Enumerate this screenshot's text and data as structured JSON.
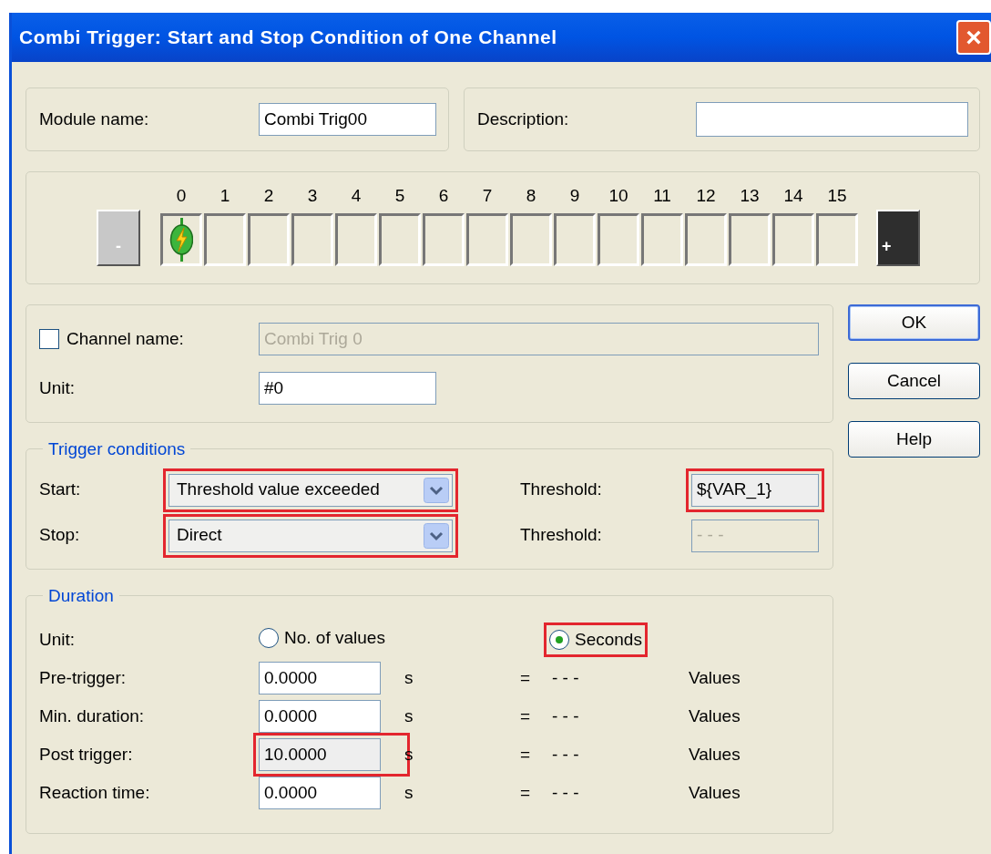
{
  "window": {
    "title": "Combi Trigger: Start and Stop Condition of One Channel",
    "close": "×"
  },
  "module": {
    "name_label": "Module name:",
    "name_value": "Combi Trig00",
    "description_label": "Description:"
  },
  "strip": {
    "prev": {
      "symbol": "-",
      "disabled": true
    },
    "next": {
      "symbol": "+",
      "disabled": false
    },
    "channels": [
      {
        "label": "0",
        "kind": "trigger"
      },
      {
        "label": "1",
        "kind": "empty"
      },
      {
        "label": "2",
        "kind": "empty"
      },
      {
        "label": "3",
        "kind": "empty"
      },
      {
        "label": "4",
        "kind": "empty"
      },
      {
        "label": "5",
        "kind": "empty"
      },
      {
        "label": "6",
        "kind": "empty"
      },
      {
        "label": "7",
        "kind": "empty"
      },
      {
        "label": "8",
        "kind": "empty"
      },
      {
        "label": "9",
        "kind": "empty"
      },
      {
        "label": "10",
        "kind": "empty"
      },
      {
        "label": "11",
        "kind": "empty"
      },
      {
        "label": "12",
        "kind": "empty"
      },
      {
        "label": "13",
        "kind": "empty"
      },
      {
        "label": "14",
        "kind": "empty"
      },
      {
        "label": "15",
        "kind": "empty"
      }
    ]
  },
  "channel": {
    "name_label": "Channel name:",
    "name_checked": false,
    "name_value": "Combi Trig 0",
    "name_disabled": true,
    "unit_label": "Unit:",
    "unit_value": "#0"
  },
  "trigger": {
    "legend": "Trigger conditions",
    "rows": [
      {
        "label": "Start:",
        "value": "Threshold value exceeded",
        "highlighted": true,
        "threshold_label": "Threshold:",
        "threshold_value": "${VAR_1}",
        "threshold_disabled": false,
        "threshold_highlighted": true
      },
      {
        "label": "Stop:",
        "value": "Direct",
        "highlighted": true,
        "threshold_label": "Threshold:",
        "threshold_value": "- - -",
        "threshold_disabled": true,
        "threshold_highlighted": false
      }
    ]
  },
  "duration": {
    "legend": "Duration",
    "unit_label": "Unit:",
    "unit_options": [
      {
        "label": "No. of values",
        "selected": false,
        "highlighted": false
      },
      {
        "label": "Seconds",
        "selected": true,
        "highlighted": true
      }
    ],
    "rows": [
      {
        "label": "Pre-trigger:",
        "value": "0.0000",
        "unit": "s",
        "equals": "=",
        "result": "- - -",
        "result_unit": "Values",
        "readonly": false,
        "highlighted": false
      },
      {
        "label": "Min. duration:",
        "value": "0.0000",
        "unit": "s",
        "equals": "=",
        "result": "- - -",
        "result_unit": "Values",
        "readonly": false,
        "highlighted": false
      },
      {
        "label": "Post trigger:",
        "value": "10.0000",
        "unit": "s",
        "equals": "=",
        "result": "- - -",
        "result_unit": "Values",
        "readonly": true,
        "highlighted": true
      },
      {
        "label": "Reaction time:",
        "value": "0.0000",
        "unit": "s",
        "equals": "=",
        "result": "- - -",
        "result_unit": "Values",
        "readonly": false,
        "highlighted": false
      }
    ]
  },
  "buttons": [
    {
      "label": "OK",
      "default": true
    },
    {
      "label": "Cancel",
      "default": false
    },
    {
      "label": "Help",
      "default": false
    }
  ]
}
